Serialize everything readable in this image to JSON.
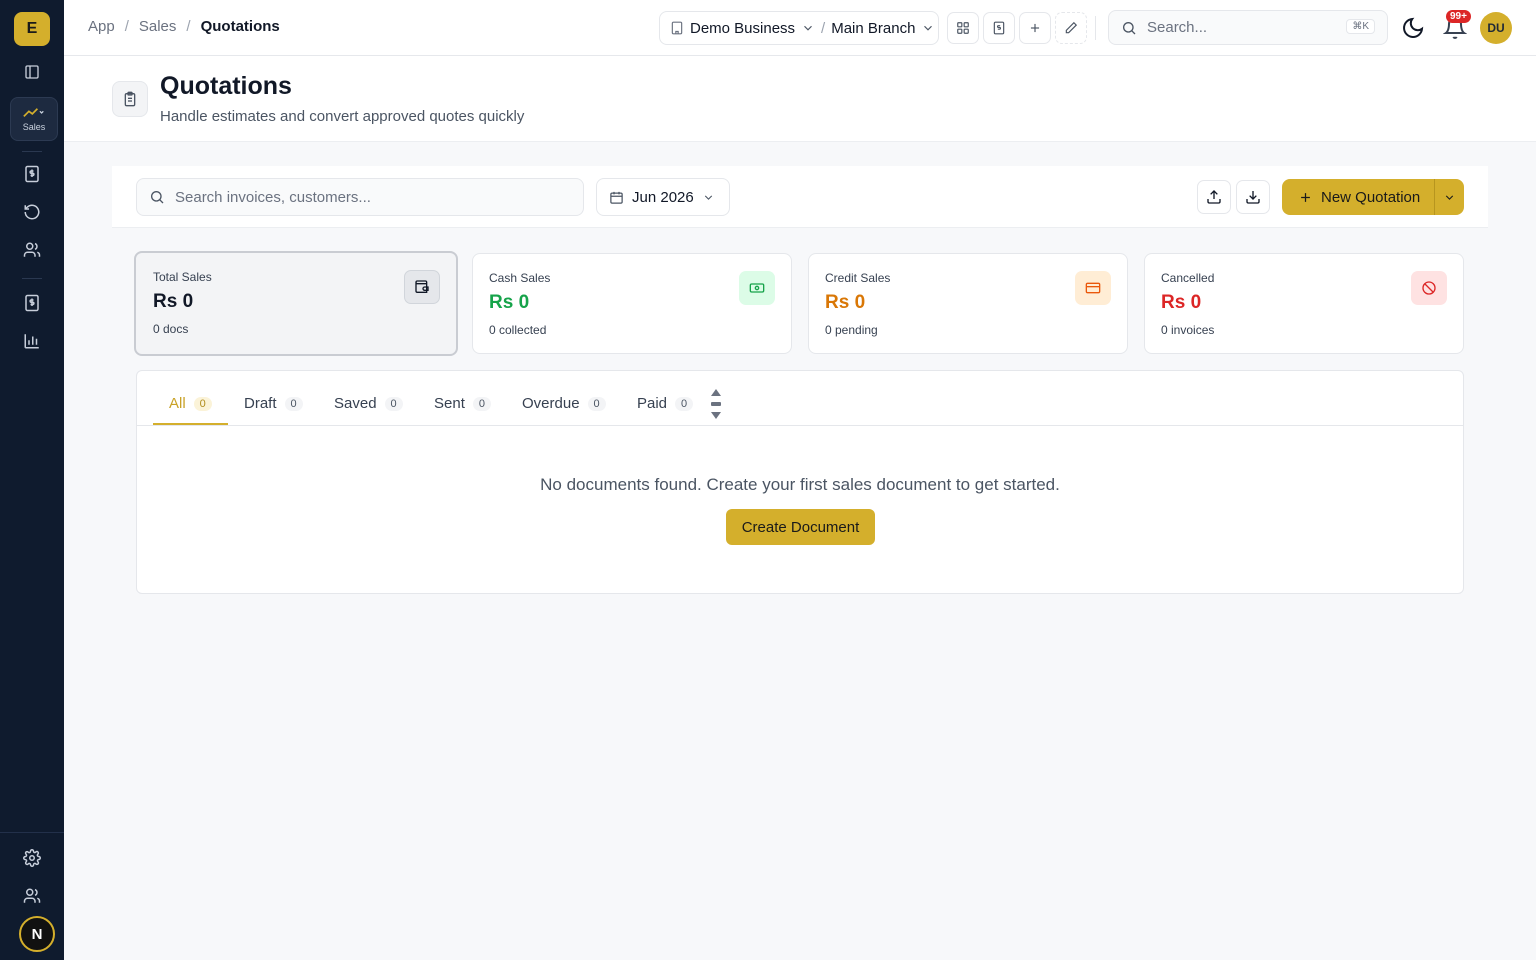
{
  "sidebar": {
    "logo": "E",
    "active_module": "Sales",
    "bottom_avatar": "N"
  },
  "topbar": {
    "breadcrumbs": [
      "App",
      "Sales",
      "Quotations"
    ],
    "business": "Demo Business",
    "branch": "Main Branch",
    "search_placeholder": "Search...",
    "search_shortcut": "⌘K",
    "notifications_badge": "99+",
    "user_initials": "DU"
  },
  "page": {
    "title": "Quotations",
    "subtitle": "Handle estimates and convert approved quotes quickly"
  },
  "toolbar": {
    "search_placeholder": "Search invoices, customers...",
    "period": "Jun 2026",
    "new_button": "New Quotation"
  },
  "stats": [
    {
      "label": "Total Sales",
      "value": "Rs 0",
      "sub": "0 docs",
      "color": "#111827"
    },
    {
      "label": "Cash Sales",
      "value": "Rs 0",
      "sub": "0 collected",
      "color": "#16a34a"
    },
    {
      "label": "Credit Sales",
      "value": "Rs 0",
      "sub": "0 pending",
      "color": "#d97706"
    },
    {
      "label": "Cancelled",
      "value": "Rs 0",
      "sub": "0 invoices",
      "color": "#dc2626"
    }
  ],
  "tabs": [
    {
      "label": "All",
      "count": "0"
    },
    {
      "label": "Draft",
      "count": "0"
    },
    {
      "label": "Saved",
      "count": "0"
    },
    {
      "label": "Sent",
      "count": "0"
    },
    {
      "label": "Overdue",
      "count": "0"
    },
    {
      "label": "Paid",
      "count": "0"
    }
  ],
  "empty": {
    "message": "No documents found. Create your first sales document to get started.",
    "button": "Create Document"
  },
  "colors": {
    "accent": "#d4af2c",
    "sidebar": "#0f1b2e"
  }
}
